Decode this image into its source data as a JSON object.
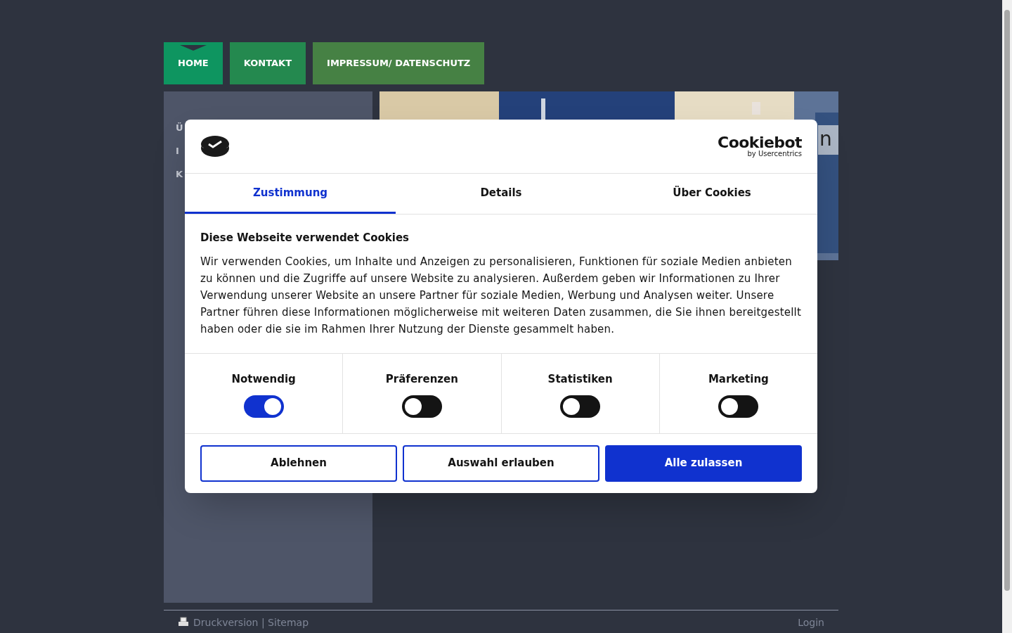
{
  "nav": [
    {
      "label": "HOME",
      "selected": true
    },
    {
      "label": "KONTAKT",
      "selected": false
    },
    {
      "label": "IMPRESSUM/ DATENSCHUTZ",
      "selected": false
    }
  ],
  "sidebar": {
    "menu_items": [
      "Ü",
      "I",
      "K"
    ]
  },
  "banner": {
    "caption_fragment": "n"
  },
  "cookie_dialog": {
    "brand": {
      "name": "Cookiebot",
      "byline": "by Usercentrics"
    },
    "tabs": [
      {
        "label": "Zustimmung",
        "selected": true
      },
      {
        "label": "Details",
        "selected": false
      },
      {
        "label": "Über Cookies",
        "selected": false
      }
    ],
    "title": "Diese Webseite verwendet Cookies",
    "body": "Wir verwenden Cookies, um Inhalte und Anzeigen zu personalisieren, Funktionen für soziale Medien anbieten zu können und die Zugriffe auf unsere Website zu analysieren. Außerdem geben wir Informationen zu Ihrer Verwendung unserer Website an unsere Partner für soziale Medien, Werbung und Analysen weiter. Unsere Partner führen diese Informationen möglicherweise mit weiteren Daten zusammen, die Sie ihnen bereitgestellt haben oder die sie im Rahmen Ihrer Nutzung der Dienste gesammelt haben.",
    "categories": [
      {
        "label": "Notwendig",
        "on": true
      },
      {
        "label": "Präferenzen",
        "on": false
      },
      {
        "label": "Statistiken",
        "on": false
      },
      {
        "label": "Marketing",
        "on": false
      }
    ],
    "buttons": [
      {
        "label": "Ablehnen",
        "kind": "outline"
      },
      {
        "label": "Auswahl erlauben",
        "kind": "outline"
      },
      {
        "label": "Alle zulassen",
        "kind": "primary"
      }
    ]
  },
  "footer": {
    "links": "Druckversion | Sitemap",
    "login": "Login"
  }
}
